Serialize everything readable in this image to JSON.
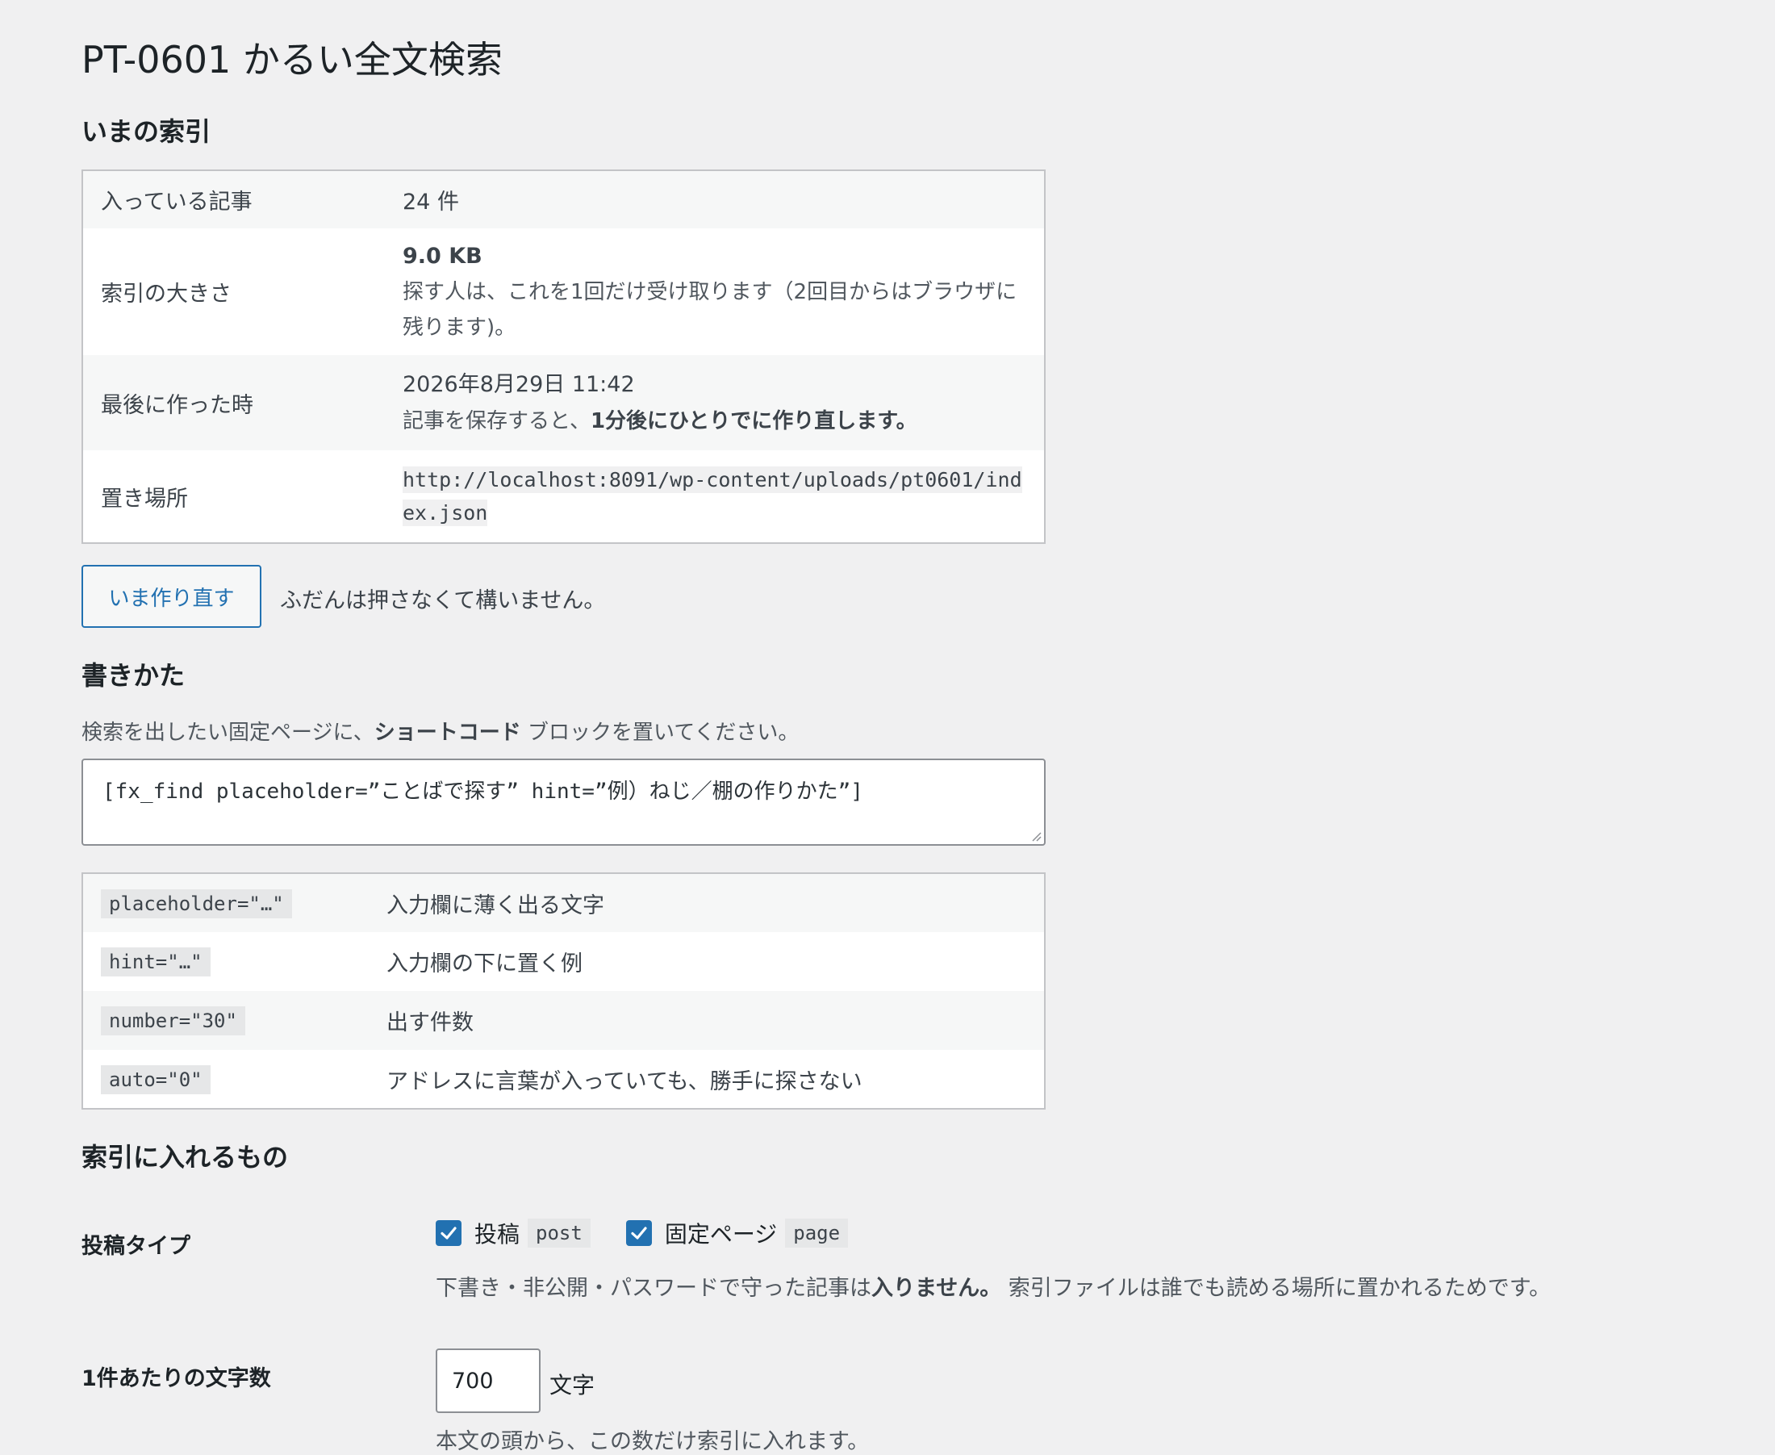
{
  "page_title": "PT-0601 かるい全文検索",
  "index_section": {
    "heading": "いまの索引",
    "rows": [
      {
        "label": "入っている記事",
        "value": "24 件"
      },
      {
        "label": "索引の大きさ",
        "value": "9.0 KB",
        "note": "探す人は、これを1回だけ受け取ります（2回目からはブラウザに残ります)。"
      },
      {
        "label": "最後に作った時",
        "value": "2026年8月29日 11:42",
        "note_prefix": "記事を保存すると、",
        "note_strong": "1分後にひとりでに作り直します。"
      },
      {
        "label": "置き場所",
        "value": "http://localhost:8091/wp-content/uploads/pt0601/index.json"
      }
    ],
    "rebuild_button": "いま作り直す",
    "rebuild_note": "ふだんは押さなくて構いません。"
  },
  "usage_section": {
    "heading": "書きかた",
    "desc_prefix": "検索を出したい固定ページに、",
    "desc_strong": "ショートコード",
    "desc_suffix": " ブロックを置いてください。",
    "shortcode": "[fx_find placeholder=”ことばで探す” hint=”例）ねじ／棚の作りかた”]",
    "params": [
      {
        "code": "placeholder=\"…\"",
        "desc": "入力欄に薄く出る文字"
      },
      {
        "code": "hint=\"…\"",
        "desc": "入力欄の下に置く例"
      },
      {
        "code": "number=\"30\"",
        "desc": "出す件数"
      },
      {
        "code": "auto=\"0\"",
        "desc": "アドレスに言葉が入っていても、勝手に探さない"
      }
    ]
  },
  "content_section": {
    "heading": "索引に入れるもの",
    "post_types_label": "投稿タイプ",
    "post_types": [
      {
        "label": "投稿",
        "code": "post",
        "checked": true
      },
      {
        "label": "固定ページ",
        "code": "page",
        "checked": true
      }
    ],
    "post_types_note_prefix": "下書き・非公開・パスワードで守った記事は",
    "post_types_note_strong": "入りません。",
    "post_types_note_suffix": " 索引ファイルは誰でも読める場所に置かれるためです。",
    "chars_label": "1件あたりの文字数",
    "chars_value": "700",
    "chars_unit": "文字",
    "chars_note": "本文の頭から、この数だけ索引に入れます。"
  },
  "colors": {
    "accent": "#2271b1",
    "background": "#f0f0f1"
  }
}
